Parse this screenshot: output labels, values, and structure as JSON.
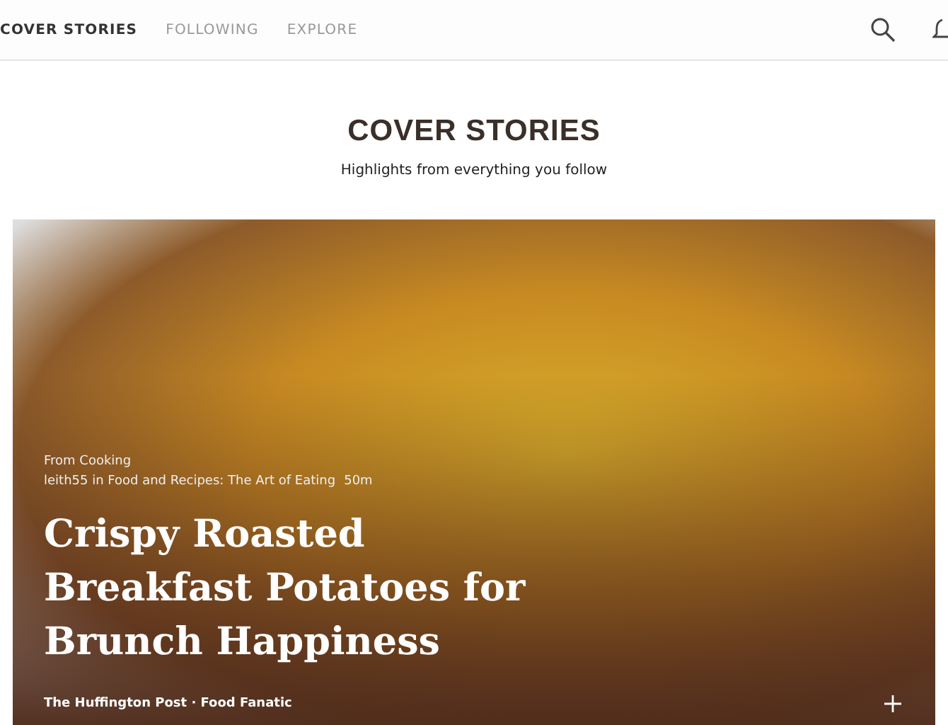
{
  "nav": {
    "tabs": [
      {
        "label": "COVER STORIES",
        "selected": true
      },
      {
        "label": "FOLLOWING",
        "selected": false
      },
      {
        "label": "EXPLORE",
        "selected": false
      }
    ]
  },
  "header": {
    "title": "COVER STORIES",
    "subtitle": "Highlights from everything you follow"
  },
  "story": {
    "source": "From Cooking",
    "author": "leith55 in Food and Recipes: The Art of Eating",
    "time": "50m",
    "title": "Crispy Roasted Breakfast Potatoes for Brunch Happiness",
    "publisher": "The Huffington Post · Food Fanatic"
  }
}
